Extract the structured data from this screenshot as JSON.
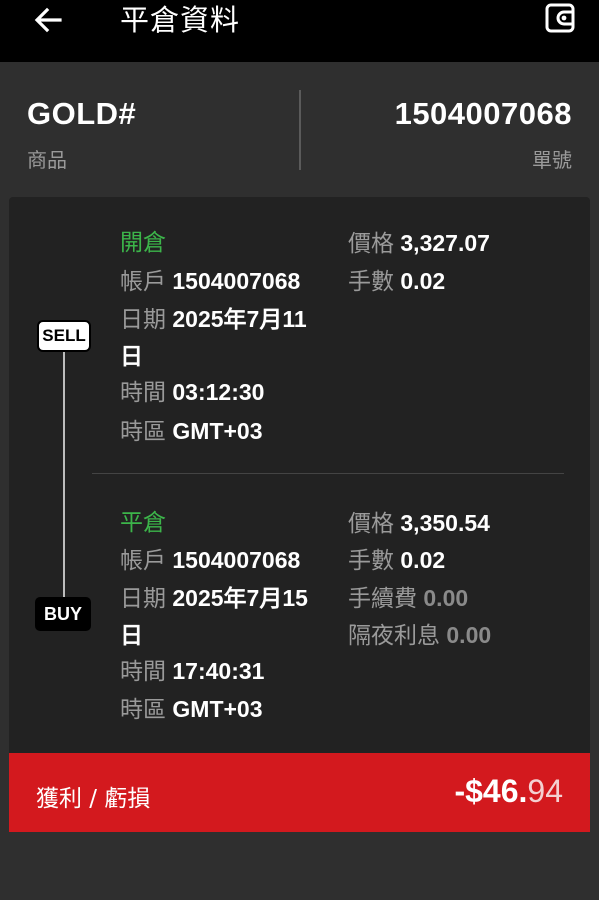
{
  "header": {
    "title": "平倉資料",
    "back_icon": "arrow-left-icon",
    "wallet_icon": "wallet-icon"
  },
  "summary": {
    "symbol": "GOLD#",
    "symbol_label": "商品",
    "order_number": "1504007068",
    "order_label": "單號"
  },
  "open": {
    "title": "開倉",
    "tag": "SELL",
    "account_label": "帳戶",
    "account": "1504007068",
    "date_label": "日期",
    "date_line1": "2025年7月11",
    "date_line2": "日",
    "time_label": "時間",
    "time": "03:12:30",
    "tz_label": "時區",
    "tz": "GMT+03",
    "price_label": "價格",
    "price": "3,327.07",
    "lots_label": "手數",
    "lots": "0.02"
  },
  "close": {
    "title": "平倉",
    "tag": "BUY",
    "account_label": "帳戶",
    "account": "1504007068",
    "date_label": "日期",
    "date_line1": "2025年7月15",
    "date_line2": "日",
    "time_label": "時間",
    "time": "17:40:31",
    "tz_label": "時區",
    "tz": "GMT+03",
    "price_label": "價格",
    "price": "3,350.54",
    "lots_label": "手數",
    "lots": "0.02",
    "commission_label": "手續費",
    "commission": "0.00",
    "swap_label": "隔夜利息",
    "swap": "0.00"
  },
  "profit": {
    "label": "獲利 / 虧損",
    "value_main": "-$46.",
    "value_dec": "94"
  },
  "colors": {
    "accent_green": "#3cb54a",
    "loss_red": "#d3191e",
    "background": "#2f2f2f",
    "card": "#222222"
  }
}
